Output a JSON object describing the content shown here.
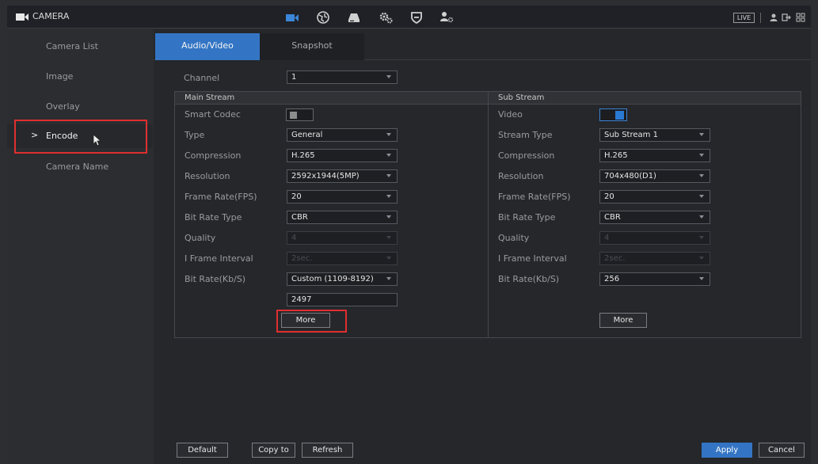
{
  "window": {
    "title": "CAMERA",
    "live_badge": "LIVE"
  },
  "top_nav": {
    "icons": [
      "camera-icon",
      "network-icon",
      "storage-icon",
      "system-settings-icon",
      "security-icon",
      "account-icon"
    ],
    "right_icons": [
      "user-icon",
      "logout-icon",
      "grid-icon"
    ]
  },
  "sidebar": {
    "items": [
      {
        "label": "Camera List"
      },
      {
        "label": "Image"
      },
      {
        "label": "Overlay"
      },
      {
        "label": "Encode",
        "active": true
      },
      {
        "label": "Camera Name"
      }
    ],
    "active_marker": ">"
  },
  "tabs": [
    {
      "label": "Audio/Video",
      "active": true
    },
    {
      "label": "Snapshot"
    }
  ],
  "channel": {
    "label": "Channel",
    "value": "1"
  },
  "main_stream": {
    "header": "Main Stream",
    "smart_codec": {
      "label": "Smart Codec",
      "enabled": false
    },
    "type": {
      "label": "Type",
      "value": "General"
    },
    "compression": {
      "label": "Compression",
      "value": "H.265"
    },
    "resolution": {
      "label": "Resolution",
      "value": "2592x1944(5MP)"
    },
    "frame_rate": {
      "label": "Frame Rate(FPS)",
      "value": "20"
    },
    "bit_rate_type": {
      "label": "Bit Rate Type",
      "value": "CBR"
    },
    "quality": {
      "label": "Quality",
      "value": "4"
    },
    "iframe_interval": {
      "label": "I Frame Interval",
      "value": "2sec."
    },
    "bit_rate": {
      "label": "Bit Rate(Kb/S)",
      "value": "Custom (1109-8192)",
      "custom_value": "2497"
    },
    "more_label": "More"
  },
  "sub_stream": {
    "header": "Sub Stream",
    "video": {
      "label": "Video",
      "enabled": true
    },
    "stream_type": {
      "label": "Stream Type",
      "value": "Sub Stream 1"
    },
    "compression": {
      "label": "Compression",
      "value": "H.265"
    },
    "resolution": {
      "label": "Resolution",
      "value": "704x480(D1)"
    },
    "frame_rate": {
      "label": "Frame Rate(FPS)",
      "value": "20"
    },
    "bit_rate_type": {
      "label": "Bit Rate Type",
      "value": "CBR"
    },
    "quality": {
      "label": "Quality",
      "value": "4"
    },
    "iframe_interval": {
      "label": "I Frame Interval",
      "value": "2sec."
    },
    "bit_rate": {
      "label": "Bit Rate(Kb/S)",
      "value": "256"
    },
    "more_label": "More"
  },
  "footer": {
    "default_label": "Default",
    "copy_to_label": "Copy to",
    "refresh_label": "Refresh",
    "apply_label": "Apply",
    "cancel_label": "Cancel"
  },
  "colors": {
    "accent": "#3375c4",
    "highlight": "#e02f2f"
  }
}
